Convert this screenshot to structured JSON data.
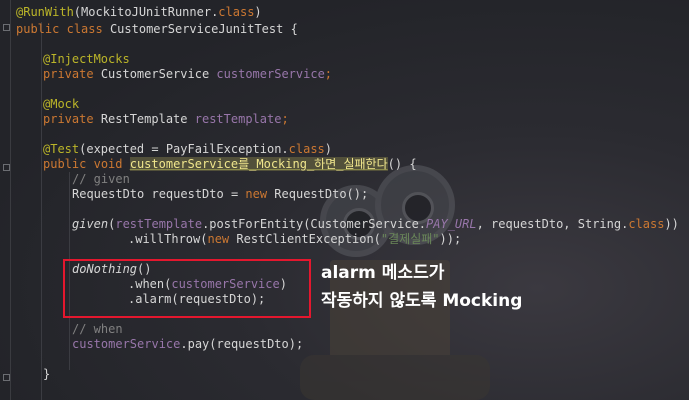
{
  "code": {
    "l1": {
      "annotation": "@RunWith",
      "rest": "(MockitoJUnitRunner.",
      "cls": "class",
      "end": ")"
    },
    "l2": {
      "kw1": "public",
      "kw2": "class",
      "name": "CustomerServiceJunitTest {"
    },
    "l4": {
      "annotation": "@InjectMocks"
    },
    "l5": {
      "kw": "private",
      "type": "CustomerService",
      "field": "customerService",
      "end": ";"
    },
    "l7": {
      "annotation": "@Mock"
    },
    "l8": {
      "kw": "private",
      "type": "RestTemplate",
      "field": "restTemplate",
      "end": ";"
    },
    "l10": {
      "annotation": "@Test",
      "open": "(expected = PayFailException.",
      "cls": "class",
      "end": ")"
    },
    "l11": {
      "kw1": "public",
      "kw2": "void",
      "method": "customerService를_Mocking_하면_실패한다",
      "rest": "() {"
    },
    "l12": {
      "comment": "// given"
    },
    "l13": {
      "type": "RequestDto requestDto = ",
      "kw": "new",
      "rest": " RequestDto();"
    },
    "l15": {
      "fn": "given",
      "p1": "(",
      "field": "restTemplate",
      "p2": ".postForEntity(CustomerService.",
      "const": "PAY_URL",
      "p3": ", requestDto, String.",
      "cls": "class",
      "p4": "))"
    },
    "l16": {
      "p1": ".willThrow(",
      "kw": "new",
      "p2": " RestClientException(",
      "str": "\"결제실패\"",
      "p3": "));"
    },
    "l18": {
      "fn": "doNothing",
      "rest": "()"
    },
    "l19": {
      "p1": ".when(",
      "field": "customerService",
      "p2": ")"
    },
    "l20": {
      "p1": ".alarm(requestDto);"
    },
    "l22": {
      "comment": "// when"
    },
    "l23": {
      "field": "customerService",
      "rest": ".pay(requestDto);"
    },
    "l25": {
      "brace": "}"
    }
  },
  "callout": {
    "line1": "alarm 메소드가",
    "line2": "작동하지 않도록 Mocking"
  },
  "colors": {
    "annotation": "#bbb529",
    "keyword": "#cc7832",
    "field": "#9876aa",
    "string": "#6a8759",
    "comment": "#808080",
    "highlight_box": "#e4172e"
  }
}
